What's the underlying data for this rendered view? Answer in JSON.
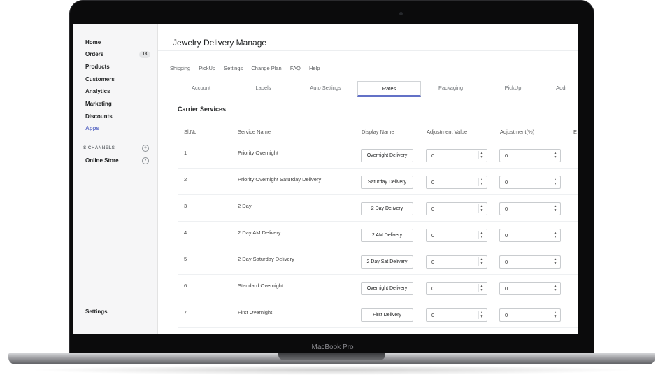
{
  "device": {
    "label": "MacBook Pro"
  },
  "sidebar": {
    "items": [
      {
        "label": "Home"
      },
      {
        "label": "Orders",
        "badge": "18"
      },
      {
        "label": "Products"
      },
      {
        "label": "Customers"
      },
      {
        "label": "Analytics"
      },
      {
        "label": "Marketing"
      },
      {
        "label": "Discounts"
      },
      {
        "label": "Apps",
        "active": true
      }
    ],
    "channels_label": "S CHANNELS",
    "online_store": "Online Store",
    "settings": "Settings"
  },
  "header": {
    "title": "Jewelry Delivery Manage"
  },
  "topnav": [
    "Shipping",
    "PickUp",
    "Settings",
    "Change Plan",
    "FAQ",
    "Help"
  ],
  "tabs": [
    "Account",
    "Labels",
    "Auto Settings",
    "Rates",
    "Packaging",
    "PickUp",
    "Addr"
  ],
  "active_tab": "Rates",
  "section": {
    "title": "Carrier Services"
  },
  "table": {
    "columns": [
      "Sl.No",
      "Service Name",
      "Display Name",
      "Adjustment Value",
      "Adjustment(%)",
      "E"
    ],
    "rows": [
      {
        "no": "1",
        "service": "Priority Overnight",
        "display": "Overnight Delivery",
        "adj_value": "0",
        "adj_pct": "0"
      },
      {
        "no": "2",
        "service": "Priority Overnight Saturday Delivery",
        "display": "Saturday Delivery",
        "adj_value": "0",
        "adj_pct": "0"
      },
      {
        "no": "3",
        "service": "2 Day",
        "display": "2 Day Delivery",
        "adj_value": "0",
        "adj_pct": "0"
      },
      {
        "no": "4",
        "service": "2 Day AM Delivery",
        "display": "2 AM Delivery",
        "adj_value": "0",
        "adj_pct": "0"
      },
      {
        "no": "5",
        "service": "2 Day Saturday Delivery",
        "display": "2 Day Sat Delivery",
        "adj_value": "0",
        "adj_pct": "0"
      },
      {
        "no": "6",
        "service": "Standard Overnight",
        "display": "Overnight Delivery",
        "adj_value": "0",
        "adj_pct": "0"
      },
      {
        "no": "7",
        "service": "First Overnight",
        "display": "First Delivery",
        "adj_value": "0",
        "adj_pct": "0"
      }
    ]
  },
  "colors": {
    "accent": "#6371c7",
    "lid": "#0b0b0c",
    "sidebar_bg": "#f6f6f7"
  }
}
